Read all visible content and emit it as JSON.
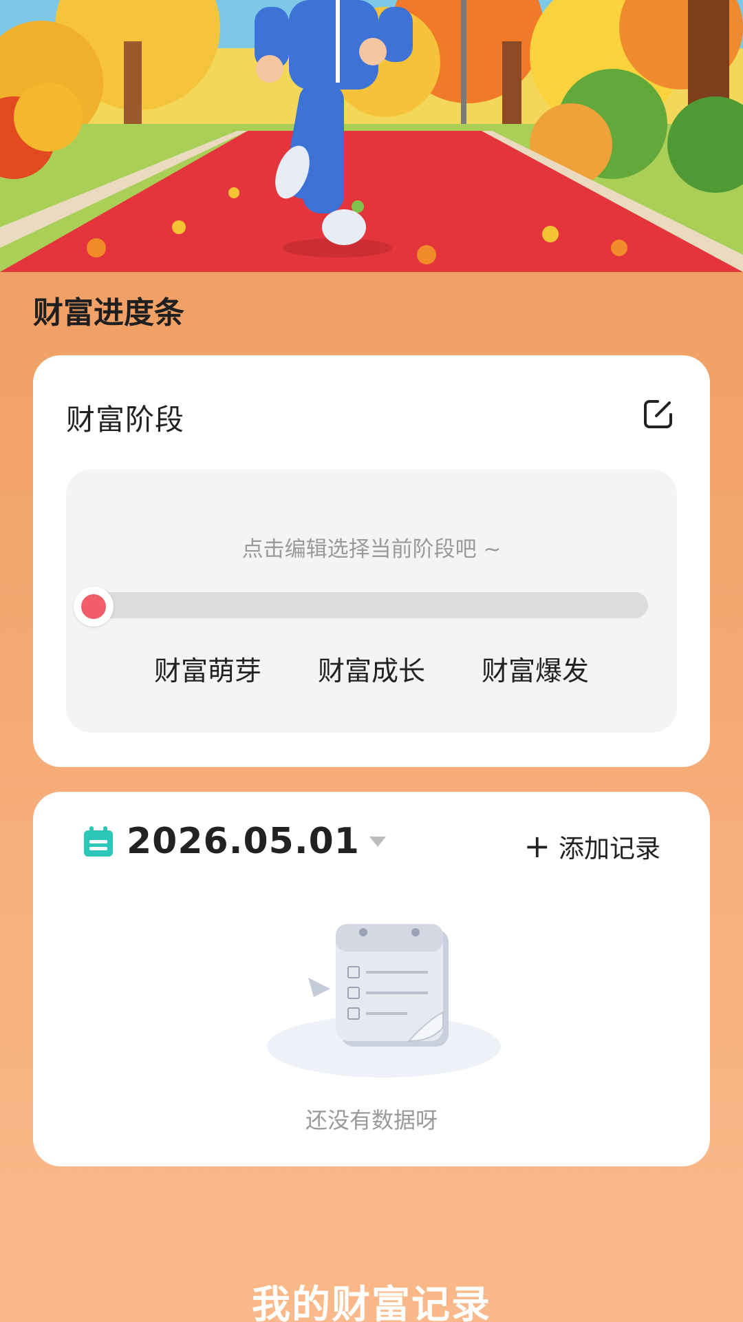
{
  "page": {
    "section_title": "财富进度条",
    "bottom_title": "我的财富记录"
  },
  "stage_card": {
    "title": "财富阶段",
    "hint": "点击编辑选择当前阶段吧 ~",
    "progress": 0,
    "stages": [
      "财富萌芽",
      "财富成长",
      "财富爆发"
    ],
    "accent_color": "#f25d6a"
  },
  "records_card": {
    "date": "2026.05.01",
    "add_label": "添加记录",
    "empty_text": "还没有数据呀",
    "calendar_color": "#2cc7b8"
  },
  "icons": {
    "edit": "edit-icon",
    "calendar": "calendar-icon",
    "dropdown": "chevron-down-icon",
    "add": "plus-icon",
    "empty": "empty-list-icon"
  }
}
